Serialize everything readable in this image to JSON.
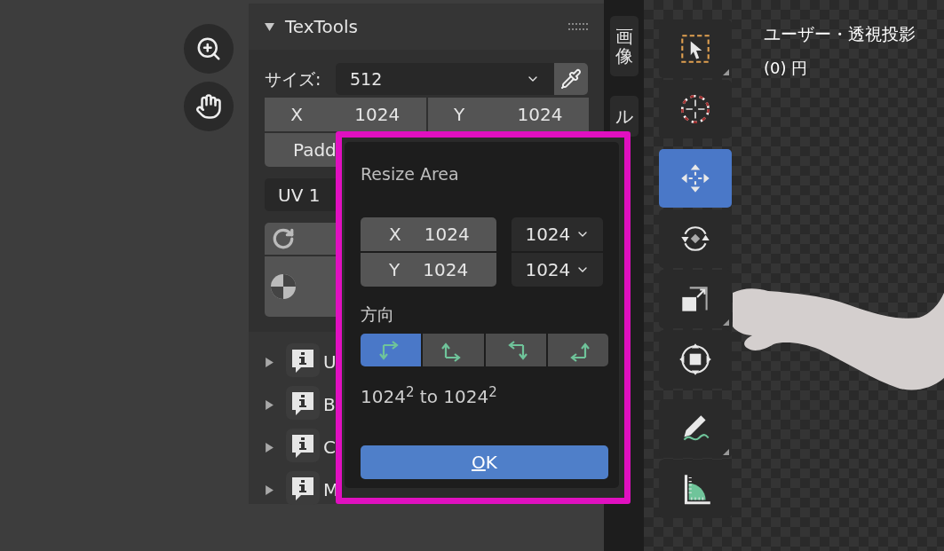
{
  "panel": {
    "title": "TexTools",
    "expanded": true,
    "size": {
      "label": "サイズ:",
      "value": "512"
    },
    "x": {
      "label": "X",
      "value": "1024"
    },
    "y": {
      "label": "Y",
      "value": "1024"
    },
    "padding": {
      "label": "Padd"
    },
    "uv": {
      "value": "UV 1"
    },
    "sections": [
      {
        "label": "U",
        "expanded": false
      },
      {
        "label": "B",
        "expanded": false
      },
      {
        "label": "C",
        "expanded": false
      },
      {
        "label": "M",
        "expanded": false
      }
    ]
  },
  "side_tabs": [
    {
      "label": "画像",
      "selected": false
    },
    {
      "label": "ル",
      "selected": false
    }
  ],
  "viewport": {
    "title": "ユーザー・透視投影",
    "subtitle": "(0) 円"
  },
  "tools": [
    {
      "kind": "select",
      "selected": false
    },
    {
      "kind": "cursor",
      "selected": false
    },
    {
      "kind": "move",
      "selected": true
    },
    {
      "kind": "rotate",
      "selected": false
    },
    {
      "kind": "scale",
      "selected": false
    },
    {
      "kind": "transform",
      "selected": false
    },
    {
      "kind": "annotate",
      "selected": false
    },
    {
      "kind": "measure",
      "selected": false
    }
  ],
  "dialog": {
    "title": "Resize Area",
    "fields": [
      {
        "label": "X",
        "value": "1024",
        "option": "1024"
      },
      {
        "label": "Y",
        "value": "1024",
        "option": "1024"
      }
    ],
    "direction": {
      "label": "方向",
      "options": [
        {
          "kind": "right_down",
          "selected": true
        },
        {
          "kind": "up_right",
          "selected": false
        },
        {
          "kind": "left_down",
          "selected": false
        },
        {
          "kind": "up_left",
          "selected": false
        }
      ]
    },
    "summary": "1024$^{2}$ to 1024$^{2}$",
    "ok": "OK"
  }
}
